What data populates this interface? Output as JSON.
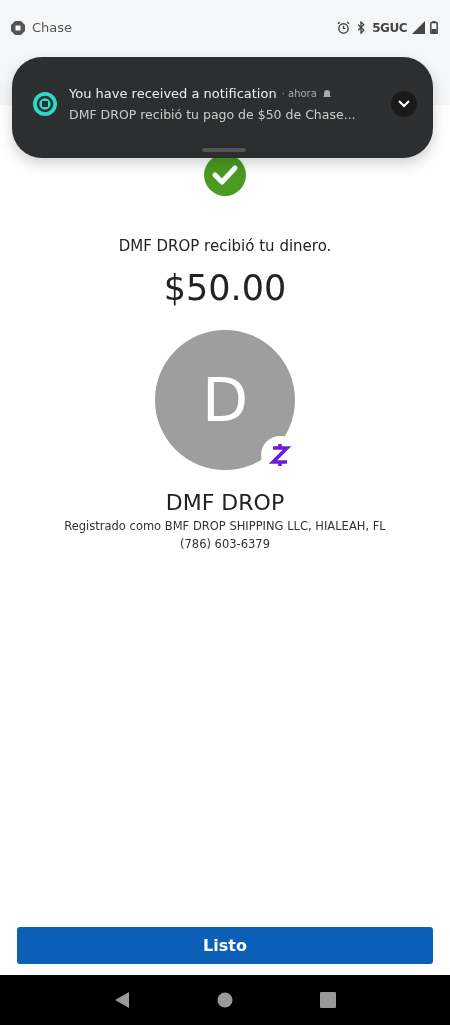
{
  "status_bar": {
    "app_name": "Chase",
    "network": "5GUC"
  },
  "notification": {
    "title": "You have received a notification",
    "time": "· ahora",
    "message": "DMF DROP recibió tu pago de $50 de Chase...",
    "expanded": false
  },
  "confirmation": {
    "message": "DMF DROP recibió tu dinero.",
    "amount": "$50.00"
  },
  "recipient": {
    "initial": "D",
    "name": "DMF DROP",
    "registered": "Registrado como BMF DROP SHIPPING LLC, HIALEAH, FL",
    "phone": "(786) 603-6379"
  },
  "buttons": [
    "Listo"
  ]
}
